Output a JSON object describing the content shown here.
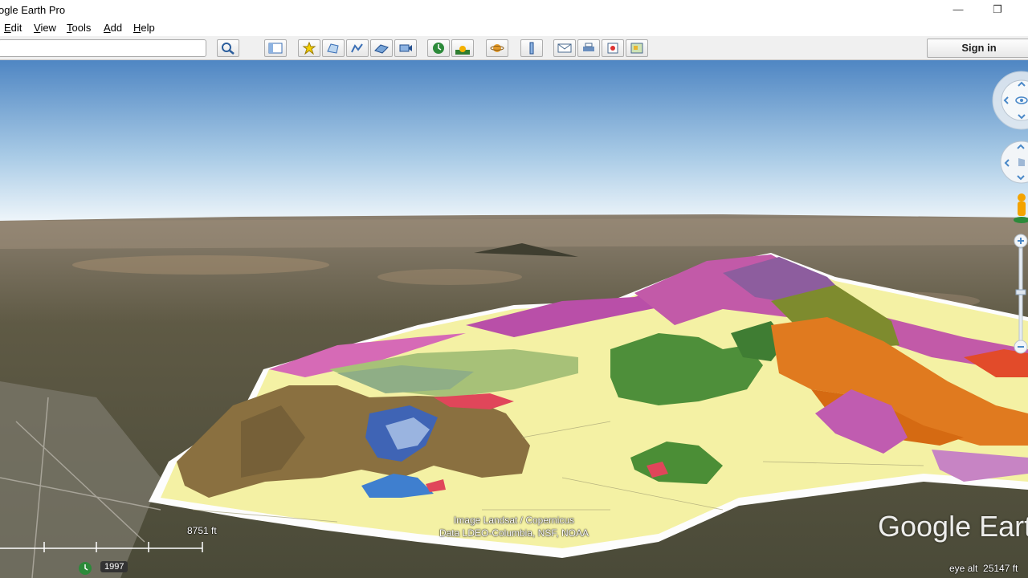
{
  "window": {
    "title": "ogle Earth Pro",
    "minimize": "—",
    "restore": "❐"
  },
  "menu": [
    "Edit",
    "View",
    "Tools",
    "Add",
    "Help"
  ],
  "search": {
    "value": "",
    "placeholder": ""
  },
  "toolbar": {
    "buttons": [
      "search-icon",
      "sidebar-icon",
      "placemark-icon",
      "polygon-icon",
      "path-icon",
      "image-overlay-icon",
      "record-tour-icon",
      "historical-imagery-icon",
      "sunlight-icon",
      "planets-icon",
      "ruler-icon",
      "email-icon",
      "print-icon",
      "save-image-icon",
      "view-in-maps-icon"
    ],
    "sign_in": "Sign in"
  },
  "map": {
    "attribution_line1": "Image Landsat / Copernicus",
    "attribution_line2": "Data LDEO-Columbia, NSF, NOAA",
    "scale_label": "8751 ft",
    "imagery_year": "1997",
    "eye_alt": "eye alt  25147 ft",
    "logo": "Google Earth"
  },
  "colors": {
    "sky_top": "#5a8fc8",
    "sky_bottom": "#e8f1f8",
    "geology_yellow": "#f4f1a4",
    "geology_green": "#4e8f3a",
    "geology_orange": "#e07a1f",
    "geology_magenta": "#c85aa8"
  }
}
